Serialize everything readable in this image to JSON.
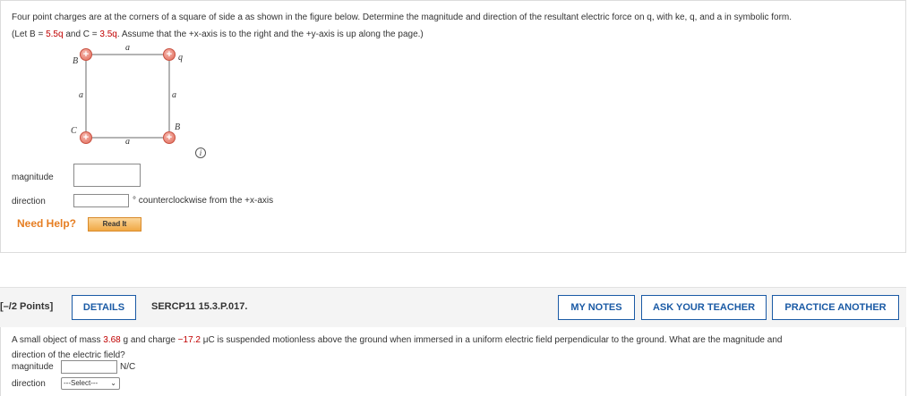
{
  "question1": {
    "line1": "Four point charges are at the corners of a square of side a as shown in the figure below. Determine the magnitude and direction of the resultant electric force on q, with ke, q, and a in symbolic form.",
    "line2_prefix": "(Let B = ",
    "B_value": "5.5q",
    "line2_mid": " and C = ",
    "C_value": "3.5q",
    "line2_suffix": ". Assume that the +x-axis is to the right and the +y-axis is up along the page.)",
    "figure": {
      "label_B_top": "B",
      "label_q": "q",
      "label_C": "C",
      "label_B_bottom": "B",
      "side_top": "a",
      "side_bottom": "a",
      "side_left": "a",
      "side_right": "a",
      "charge_symbol": "+",
      "info_symbol": "i"
    },
    "magnitude_label": "magnitude",
    "magnitude_value": "",
    "direction_label": "direction",
    "direction_value": "",
    "direction_unit": "° counterclockwise from the +x-axis",
    "need_help": "Need Help?",
    "read_it": "Read It"
  },
  "question2": {
    "points": "[–/2 Points]",
    "details": "DETAILS",
    "question_id": "SERCP11 15.3.P.017.",
    "my_notes": "MY NOTES",
    "ask_teacher": "ASK YOUR TEACHER",
    "practice_another": "PRACTICE ANOTHER",
    "text_prefix": "A small object of mass ",
    "mass_value": "3.68",
    "text_mid": " g and charge ",
    "charge_value": "−17.2",
    "text_suffix": " μC is suspended motionless above the ground when immersed in a uniform electric field perpendicular to the ground. What are the magnitude and",
    "text_line2": "direction of the electric field?",
    "magnitude_label": "magnitude",
    "magnitude_value": "",
    "magnitude_unit": "N/C",
    "direction_label": "direction",
    "direction_select": "---Select---"
  },
  "colors": {
    "accent_blue": "#1a5aa5",
    "highlight_red": "#c00000",
    "help_orange": "#e67e22"
  }
}
